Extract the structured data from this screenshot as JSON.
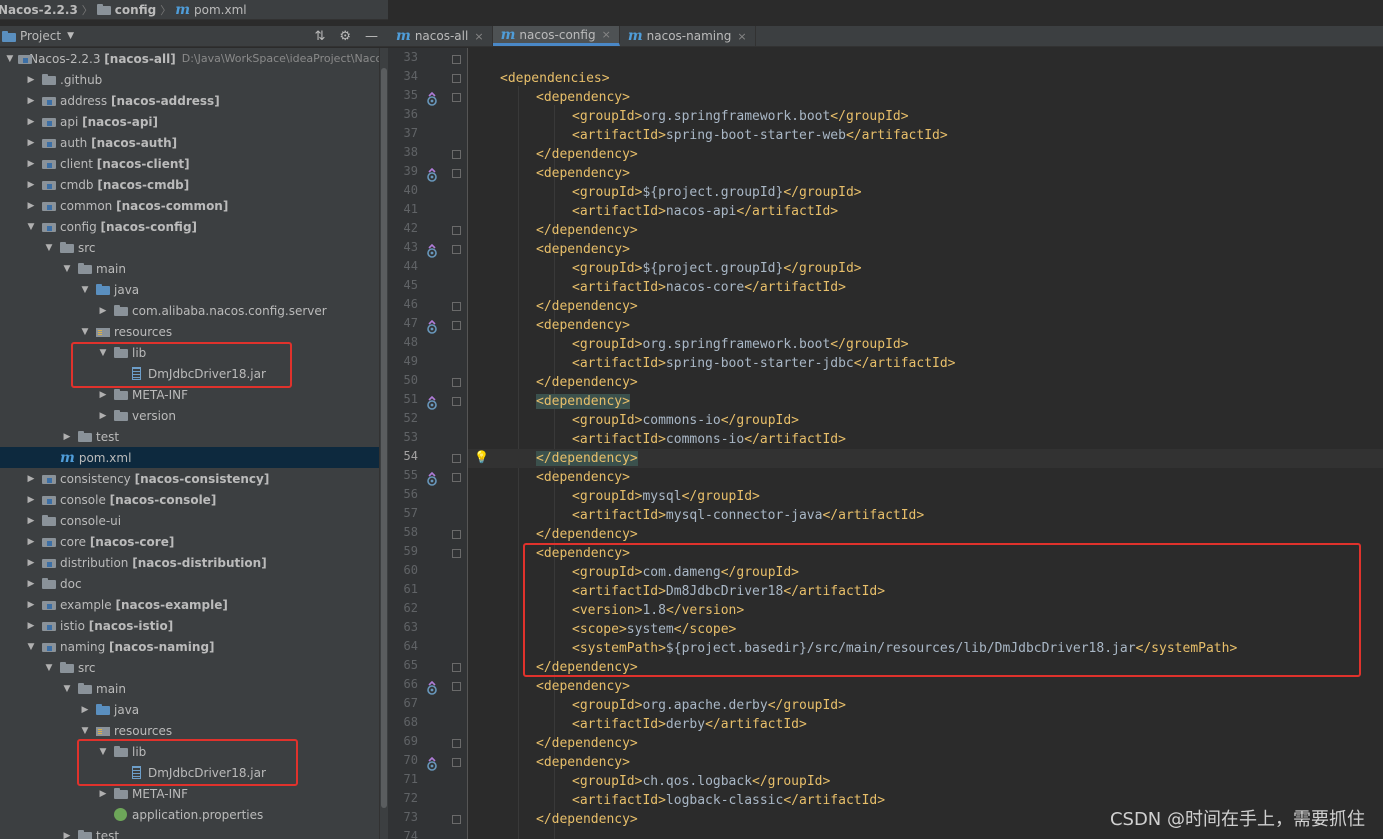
{
  "breadcrumb": {
    "root": "Nacos-2.2.3",
    "folder": "config",
    "file": "pom.xml"
  },
  "project_panel": {
    "title": "Project"
  },
  "tree": [
    {
      "indent": 0,
      "arrow": "down",
      "icon": "module",
      "label": "Nacos-2.2.3 ",
      "bold": "[nacos-all]",
      "path": "D:\\Java\\WorkSpace\\ideaProject\\Nacos"
    },
    {
      "indent": 1,
      "arrow": "right",
      "icon": "folder",
      "label": ".github",
      "bold": ""
    },
    {
      "indent": 1,
      "arrow": "right",
      "icon": "module",
      "label": "address ",
      "bold": "[nacos-address]"
    },
    {
      "indent": 1,
      "arrow": "right",
      "icon": "module",
      "label": "api ",
      "bold": "[nacos-api]"
    },
    {
      "indent": 1,
      "arrow": "right",
      "icon": "module",
      "label": "auth ",
      "bold": "[nacos-auth]"
    },
    {
      "indent": 1,
      "arrow": "right",
      "icon": "module",
      "label": "client ",
      "bold": "[nacos-client]"
    },
    {
      "indent": 1,
      "arrow": "right",
      "icon": "module",
      "label": "cmdb ",
      "bold": "[nacos-cmdb]"
    },
    {
      "indent": 1,
      "arrow": "right",
      "icon": "module",
      "label": "common ",
      "bold": "[nacos-common]"
    },
    {
      "indent": 1,
      "arrow": "down",
      "icon": "module",
      "label": "config ",
      "bold": "[nacos-config]"
    },
    {
      "indent": 2,
      "arrow": "down",
      "icon": "folder",
      "label": "src",
      "bold": ""
    },
    {
      "indent": 3,
      "arrow": "down",
      "icon": "folder",
      "label": "main",
      "bold": ""
    },
    {
      "indent": 4,
      "arrow": "down",
      "icon": "folder-blue",
      "label": "java",
      "bold": ""
    },
    {
      "indent": 5,
      "arrow": "right",
      "icon": "folder",
      "label": "com.alibaba.nacos.config.server",
      "bold": ""
    },
    {
      "indent": 4,
      "arrow": "down",
      "icon": "resources",
      "label": "resources",
      "bold": ""
    },
    {
      "indent": 5,
      "arrow": "down",
      "icon": "folder",
      "label": "lib",
      "bold": ""
    },
    {
      "indent": 6,
      "arrow": "none",
      "icon": "jar",
      "label": "DmJdbcDriver18.jar",
      "bold": ""
    },
    {
      "indent": 5,
      "arrow": "right",
      "icon": "folder",
      "label": "META-INF",
      "bold": ""
    },
    {
      "indent": 5,
      "arrow": "right",
      "icon": "folder",
      "label": "version",
      "bold": ""
    },
    {
      "indent": 3,
      "arrow": "right",
      "icon": "folder",
      "label": "test",
      "bold": ""
    },
    {
      "indent": 2,
      "arrow": "none",
      "icon": "maven",
      "label": "pom.xml",
      "bold": "",
      "selected": true
    },
    {
      "indent": 1,
      "arrow": "right",
      "icon": "module",
      "label": "consistency ",
      "bold": "[nacos-consistency]"
    },
    {
      "indent": 1,
      "arrow": "right",
      "icon": "module",
      "label": "console ",
      "bold": "[nacos-console]"
    },
    {
      "indent": 1,
      "arrow": "right",
      "icon": "folder",
      "label": "console-ui",
      "bold": ""
    },
    {
      "indent": 1,
      "arrow": "right",
      "icon": "module",
      "label": "core ",
      "bold": "[nacos-core]"
    },
    {
      "indent": 1,
      "arrow": "right",
      "icon": "module",
      "label": "distribution ",
      "bold": "[nacos-distribution]"
    },
    {
      "indent": 1,
      "arrow": "right",
      "icon": "folder",
      "label": "doc",
      "bold": ""
    },
    {
      "indent": 1,
      "arrow": "right",
      "icon": "module",
      "label": "example ",
      "bold": "[nacos-example]"
    },
    {
      "indent": 1,
      "arrow": "right",
      "icon": "module",
      "label": "istio ",
      "bold": "[nacos-istio]"
    },
    {
      "indent": 1,
      "arrow": "down",
      "icon": "module",
      "label": "naming ",
      "bold": "[nacos-naming]"
    },
    {
      "indent": 2,
      "arrow": "down",
      "icon": "folder",
      "label": "src",
      "bold": ""
    },
    {
      "indent": 3,
      "arrow": "down",
      "icon": "folder",
      "label": "main",
      "bold": ""
    },
    {
      "indent": 4,
      "arrow": "right",
      "icon": "folder-blue",
      "label": "java",
      "bold": ""
    },
    {
      "indent": 4,
      "arrow": "down",
      "icon": "resources",
      "label": "resources",
      "bold": ""
    },
    {
      "indent": 5,
      "arrow": "down",
      "icon": "folder",
      "label": "lib",
      "bold": ""
    },
    {
      "indent": 6,
      "arrow": "none",
      "icon": "jar",
      "label": "DmJdbcDriver18.jar",
      "bold": ""
    },
    {
      "indent": 5,
      "arrow": "right",
      "icon": "folder",
      "label": "META-INF",
      "bold": ""
    },
    {
      "indent": 5,
      "arrow": "none",
      "icon": "properties",
      "label": "application.properties",
      "bold": ""
    },
    {
      "indent": 3,
      "arrow": "right",
      "icon": "folder",
      "label": "test",
      "bold": ""
    }
  ],
  "tabs": [
    {
      "label": "nacos-all",
      "active": false
    },
    {
      "label": "nacos-config",
      "active": true
    },
    {
      "label": "nacos-naming",
      "active": false
    }
  ],
  "editor": {
    "current_line": 54,
    "lines": [
      {
        "n": 33,
        "indent": 0,
        "text": "",
        "mark": false,
        "fold": true
      },
      {
        "n": 34,
        "indent": 0,
        "text": "<dependencies>",
        "mark": false,
        "fold": true
      },
      {
        "n": 35,
        "indent": 1,
        "text": "<dependency>",
        "mark": true,
        "fold": true
      },
      {
        "n": 36,
        "indent": 2,
        "text": "<groupId>org.springframework.boot</groupId>"
      },
      {
        "n": 37,
        "indent": 2,
        "text": "<artifactId>spring-boot-starter-web</artifactId>"
      },
      {
        "n": 38,
        "indent": 1,
        "text": "</dependency>",
        "fold": true
      },
      {
        "n": 39,
        "indent": 1,
        "text": "<dependency>",
        "mark": true,
        "fold": true
      },
      {
        "n": 40,
        "indent": 2,
        "text": "<groupId>${project.groupId}</groupId>"
      },
      {
        "n": 41,
        "indent": 2,
        "text": "<artifactId>nacos-api</artifactId>"
      },
      {
        "n": 42,
        "indent": 1,
        "text": "</dependency>",
        "fold": true
      },
      {
        "n": 43,
        "indent": 1,
        "text": "<dependency>",
        "mark": true,
        "fold": true
      },
      {
        "n": 44,
        "indent": 2,
        "text": "<groupId>${project.groupId}</groupId>"
      },
      {
        "n": 45,
        "indent": 2,
        "text": "<artifactId>nacos-core</artifactId>"
      },
      {
        "n": 46,
        "indent": 1,
        "text": "</dependency>",
        "fold": true
      },
      {
        "n": 47,
        "indent": 1,
        "text": "<dependency>",
        "mark": true,
        "fold": true
      },
      {
        "n": 48,
        "indent": 2,
        "text": "<groupId>org.springframework.boot</groupId>"
      },
      {
        "n": 49,
        "indent": 2,
        "text": "<artifactId>spring-boot-starter-jdbc</artifactId>"
      },
      {
        "n": 50,
        "indent": 1,
        "text": "</dependency>",
        "fold": true
      },
      {
        "n": 51,
        "indent": 1,
        "text": "<dependency>",
        "mark": true,
        "fold": true,
        "hl": true
      },
      {
        "n": 52,
        "indent": 2,
        "text": "<groupId>commons-io</groupId>"
      },
      {
        "n": 53,
        "indent": 2,
        "text": "<artifactId>commons-io</artifactId>"
      },
      {
        "n": 54,
        "indent": 1,
        "text": "</dependency>",
        "fold": true,
        "hl": true,
        "bulb": true
      },
      {
        "n": 55,
        "indent": 1,
        "text": "<dependency>",
        "mark": true,
        "fold": true
      },
      {
        "n": 56,
        "indent": 2,
        "text": "<groupId>mysql</groupId>"
      },
      {
        "n": 57,
        "indent": 2,
        "text": "<artifactId>mysql-connector-java</artifactId>"
      },
      {
        "n": 58,
        "indent": 1,
        "text": "</dependency>",
        "fold": true
      },
      {
        "n": 59,
        "indent": 1,
        "text": "<dependency>",
        "fold": true
      },
      {
        "n": 60,
        "indent": 2,
        "text": "<groupId>com.dameng</groupId>"
      },
      {
        "n": 61,
        "indent": 2,
        "text": "<artifactId>Dm8JdbcDriver18</artifactId>"
      },
      {
        "n": 62,
        "indent": 2,
        "text": "<version>1.8</version>"
      },
      {
        "n": 63,
        "indent": 2,
        "text": "<scope>system</scope>"
      },
      {
        "n": 64,
        "indent": 2,
        "text": "<systemPath>${project.basedir}/src/main/resources/lib/DmJdbcDriver18.jar</systemPath>"
      },
      {
        "n": 65,
        "indent": 1,
        "text": "</dependency>",
        "fold": true
      },
      {
        "n": 66,
        "indent": 1,
        "text": "<dependency>",
        "mark": true,
        "fold": true
      },
      {
        "n": 67,
        "indent": 2,
        "text": "<groupId>org.apache.derby</groupId>"
      },
      {
        "n": 68,
        "indent": 2,
        "text": "<artifactId>derby</artifactId>"
      },
      {
        "n": 69,
        "indent": 1,
        "text": "</dependency>",
        "fold": true
      },
      {
        "n": 70,
        "indent": 1,
        "text": "<dependency>",
        "mark": true,
        "fold": true
      },
      {
        "n": 71,
        "indent": 2,
        "text": "<groupId>ch.qos.logback</groupId>"
      },
      {
        "n": 72,
        "indent": 2,
        "text": "<artifactId>logback-classic</artifactId>"
      },
      {
        "n": 73,
        "indent": 1,
        "text": "</dependency>",
        "fold": true
      },
      {
        "n": 74,
        "indent": 0,
        "text": ""
      }
    ]
  },
  "watermark": "CSDN @时间在手上，需要抓住",
  "colors": {
    "tag": "#e8bf6a",
    "text": "#a9b7c6",
    "highlight_box": "#e0322c",
    "selection": "#0d293e"
  }
}
